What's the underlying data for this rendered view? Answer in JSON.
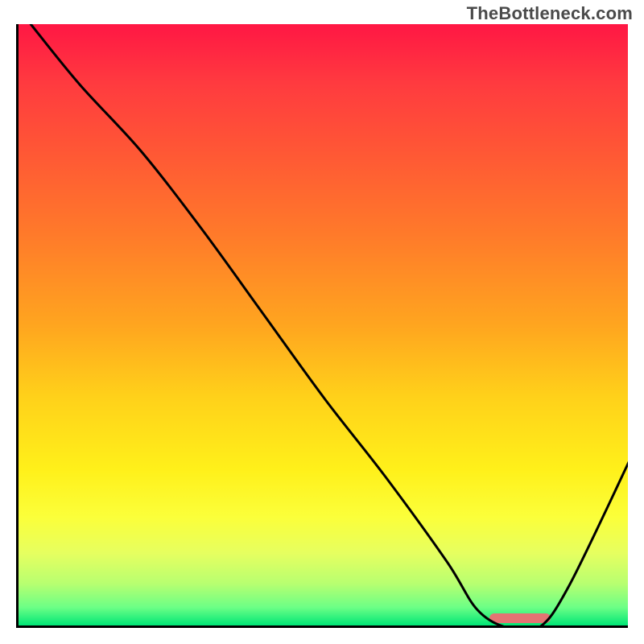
{
  "watermark": "TheBottleneck.com",
  "chart_data": {
    "type": "line",
    "title": "",
    "xlabel": "",
    "ylabel": "",
    "xlim": [
      0,
      100
    ],
    "ylim": [
      0,
      100
    ],
    "grid": false,
    "series": [
      {
        "name": "curve",
        "x": [
          2,
          10,
          20,
          30,
          40,
          50,
          60,
          70,
          75,
          80,
          85,
          90,
          100
        ],
        "values": [
          100,
          90,
          79,
          66,
          52,
          38,
          25,
          11,
          3,
          0,
          0,
          7,
          28
        ]
      }
    ],
    "marker": {
      "x_start": 77,
      "x_end": 87,
      "color": "#e57373"
    },
    "background_gradient_stops": [
      {
        "pos": 0,
        "color": "#ff1744"
      },
      {
        "pos": 10,
        "color": "#ff3b3f"
      },
      {
        "pos": 20,
        "color": "#ff5436"
      },
      {
        "pos": 35,
        "color": "#ff7a2a"
      },
      {
        "pos": 50,
        "color": "#ffa51f"
      },
      {
        "pos": 62,
        "color": "#ffd11a"
      },
      {
        "pos": 74,
        "color": "#fff01a"
      },
      {
        "pos": 82,
        "color": "#fbff3a"
      },
      {
        "pos": 88,
        "color": "#e6ff60"
      },
      {
        "pos": 93,
        "color": "#b8ff70"
      },
      {
        "pos": 97,
        "color": "#6cff86"
      },
      {
        "pos": 100,
        "color": "#00e676"
      }
    ]
  }
}
